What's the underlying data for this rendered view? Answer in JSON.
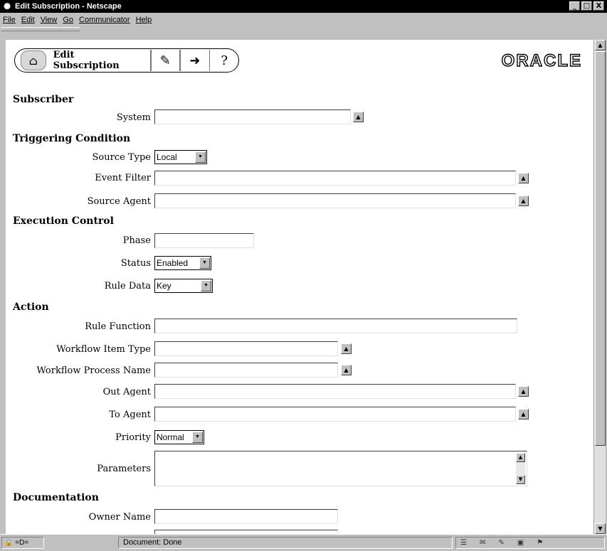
{
  "window": {
    "title": "Edit Subscription - Netscape",
    "buttons": [
      "_",
      "□",
      "X"
    ]
  },
  "menu": [
    "File",
    "Edit",
    "View",
    "Go",
    "Communicator",
    "Help"
  ],
  "toolbar": {
    "title": "Edit Subscription"
  },
  "logo": "ORACLE",
  "sections": {
    "subscriber": "Subscriber",
    "triggering": "Triggering Condition",
    "execution": "Execution Control",
    "action": "Action",
    "documentation": "Documentation"
  },
  "fields": {
    "system": {
      "label": "System",
      "value": ""
    },
    "source_type": {
      "label": "Source Type",
      "value": "Local"
    },
    "event_filter": {
      "label": "Event Filter",
      "value": ""
    },
    "source_agent": {
      "label": "Source Agent",
      "value": ""
    },
    "phase": {
      "label": "Phase",
      "value": ""
    },
    "status": {
      "label": "Status",
      "value": "Enabled"
    },
    "rule_data": {
      "label": "Rule Data",
      "value": "Key"
    },
    "rule_function": {
      "label": "Rule Function",
      "value": ""
    },
    "wf_item_type": {
      "label": "Workflow Item Type",
      "value": ""
    },
    "wf_process_name": {
      "label": "Workflow Process Name",
      "value": ""
    },
    "out_agent": {
      "label": "Out Agent",
      "value": ""
    },
    "to_agent": {
      "label": "To Agent",
      "value": ""
    },
    "priority": {
      "label": "Priority",
      "value": "Normal"
    },
    "parameters": {
      "label": "Parameters",
      "value": ""
    },
    "owner_name": {
      "label": "Owner Name",
      "value": ""
    }
  },
  "status_bar": {
    "text": "Document: Done"
  }
}
